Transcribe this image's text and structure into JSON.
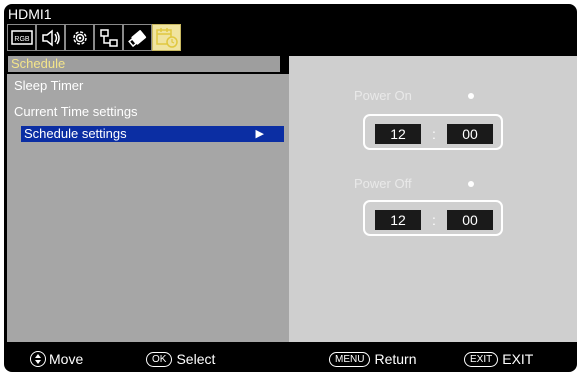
{
  "source": "HDMI1",
  "toolbar": {
    "icons": [
      {
        "name": "picture-icon",
        "label": "RGB"
      },
      {
        "name": "audio-icon"
      },
      {
        "name": "setup-gear-icon"
      },
      {
        "name": "network-icon"
      },
      {
        "name": "usb-icon"
      },
      {
        "name": "schedule-calendar-icon",
        "active": true
      }
    ]
  },
  "section_title": "Schedule",
  "menu": {
    "items": [
      {
        "label": "Sleep Timer"
      },
      {
        "label": "Current Time settings"
      },
      {
        "label": "Schedule settings",
        "selected": true
      }
    ]
  },
  "schedule": {
    "power_on": {
      "label": "Power On",
      "hour": "12",
      "minute": "00",
      "separator": ":"
    },
    "power_off": {
      "label": "Power Off",
      "hour": "12",
      "minute": "00",
      "separator": ":"
    }
  },
  "footer": {
    "move": "Move",
    "ok_key": "OK",
    "select": "Select",
    "menu_key": "MENU",
    "return": "Return",
    "exit_key": "EXIT",
    "exit": "EXIT"
  },
  "colors": {
    "selection": "#0b2ea3",
    "panel_left": "#a6a6a6",
    "panel_right": "#cfcfcf",
    "section_text": "#f4e58a"
  }
}
